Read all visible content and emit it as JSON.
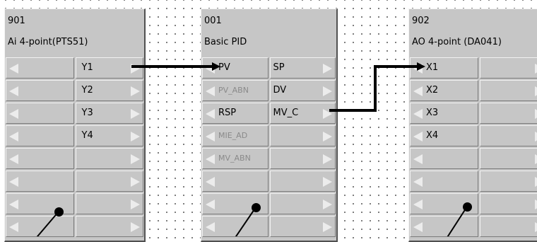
{
  "blocks": [
    {
      "id": "901",
      "name": "Ai 4-point(PTS51)",
      "rows": [
        {
          "in": "",
          "out": "Y1"
        },
        {
          "in": "",
          "out": "Y2"
        },
        {
          "in": "",
          "out": "Y3"
        },
        {
          "in": "",
          "out": "Y4"
        },
        {
          "in": "",
          "out": ""
        },
        {
          "in": "",
          "out": ""
        },
        {
          "in": "",
          "out": ""
        },
        {
          "in": "",
          "out": ""
        }
      ]
    },
    {
      "id": "001",
      "name": "Basic PID",
      "rows": [
        {
          "in": "PV",
          "out": "SP"
        },
        {
          "in": "PV_ABN",
          "out": "DV",
          "in_dim": true
        },
        {
          "in": "RSP",
          "out": "MV_C"
        },
        {
          "in": "MIE_AD",
          "out": "",
          "in_dim": true
        },
        {
          "in": "MV_ABN",
          "out": "",
          "in_dim": true
        },
        {
          "in": "",
          "out": ""
        },
        {
          "in": "",
          "out": ""
        },
        {
          "in": "",
          "out": ""
        }
      ]
    },
    {
      "id": "902",
      "name": "AO 4-point (DA041)",
      "rows": [
        {
          "in": "X1",
          "out": ""
        },
        {
          "in": "X2",
          "out": ""
        },
        {
          "in": "X3",
          "out": ""
        },
        {
          "in": "X4",
          "out": ""
        },
        {
          "in": "",
          "out": ""
        },
        {
          "in": "",
          "out": ""
        },
        {
          "in": "",
          "out": ""
        },
        {
          "in": "",
          "out": ""
        }
      ]
    }
  ],
  "connections": [
    {
      "from": "901.Y1",
      "to": "001.PV"
    },
    {
      "from": "001.MV_C",
      "to": "902.X1"
    }
  ]
}
